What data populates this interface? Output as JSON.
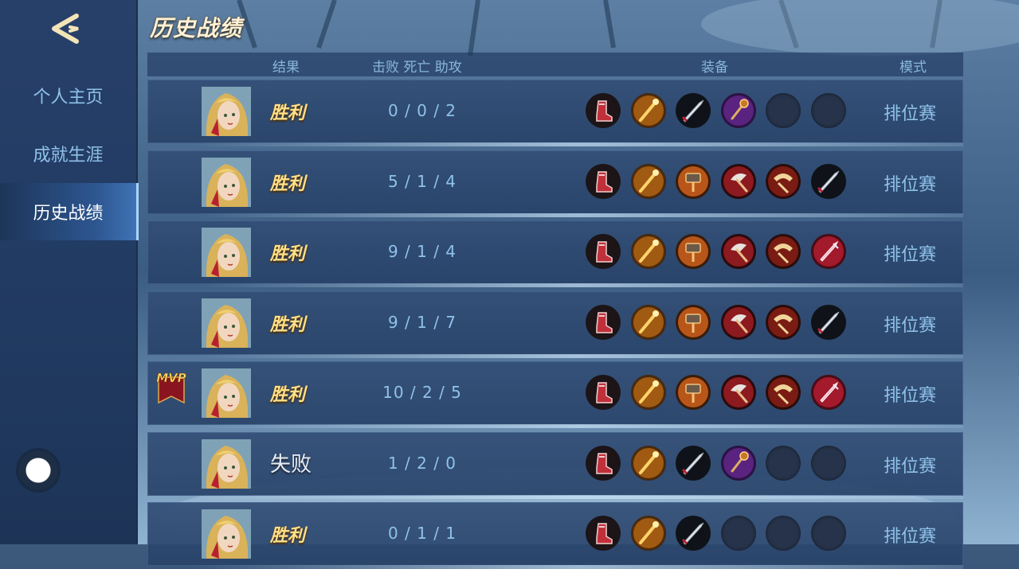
{
  "sidebar": {
    "items": [
      {
        "label": "个人主页",
        "active": false
      },
      {
        "label": "成就生涯",
        "active": false
      },
      {
        "label": "历史战绩",
        "active": true
      }
    ]
  },
  "page_title": "历史战绩",
  "header": {
    "result": "结果",
    "kda": "击败 死亡 助攻",
    "equipment": "装备",
    "mode": "模式"
  },
  "rows": [
    {
      "result": "胜利",
      "win": true,
      "mvp": false,
      "kda": "0 / 0 / 2",
      "mode": "排位赛",
      "items": [
        "boots-icon",
        "staff-icon",
        "sword-icon",
        "scepter-icon",
        "empty-slot",
        "empty-slot"
      ]
    },
    {
      "result": "胜利",
      "win": true,
      "mvp": false,
      "kda": "5 / 1 / 4",
      "mode": "排位赛",
      "items": [
        "boots-icon",
        "staff-icon",
        "hammer-icon",
        "axe-icon",
        "crest-icon",
        "sword-icon"
      ]
    },
    {
      "result": "胜利",
      "win": true,
      "mvp": false,
      "kda": "9 / 1 / 4",
      "mode": "排位赛",
      "items": [
        "boots-icon",
        "staff-icon",
        "hammer-icon",
        "axe-icon",
        "crest-icon",
        "crystal-blade-icon"
      ]
    },
    {
      "result": "胜利",
      "win": true,
      "mvp": false,
      "kda": "9 / 1 / 7",
      "mode": "排位赛",
      "items": [
        "boots-icon",
        "staff-icon",
        "hammer-icon",
        "axe-icon",
        "crest-icon",
        "sword-icon"
      ]
    },
    {
      "result": "胜利",
      "win": true,
      "mvp": true,
      "mvp_label": "MVP",
      "kda": "10 / 2 / 5",
      "mode": "排位赛",
      "items": [
        "boots-icon",
        "staff-icon",
        "hammer-icon",
        "axe-icon",
        "crest-icon",
        "crystal-blade-icon"
      ]
    },
    {
      "result": "失败",
      "win": false,
      "mvp": false,
      "kda": "1 / 2 / 0",
      "mode": "排位赛",
      "items": [
        "boots-icon",
        "staff-icon",
        "sword-icon",
        "scepter-icon",
        "empty-slot",
        "empty-slot"
      ]
    },
    {
      "result": "胜利",
      "win": true,
      "mvp": false,
      "kda": "0 / 1 / 1",
      "mode": "排位赛",
      "items": [
        "boots-icon",
        "staff-icon",
        "sword-icon",
        "empty-slot",
        "empty-slot",
        "empty-slot"
      ]
    }
  ],
  "colors": {
    "win_text": "#ffe08a",
    "lose_text": "#e9eef5",
    "accent_blue": "#8fc2ea",
    "active_tab": "#3f73b5"
  }
}
